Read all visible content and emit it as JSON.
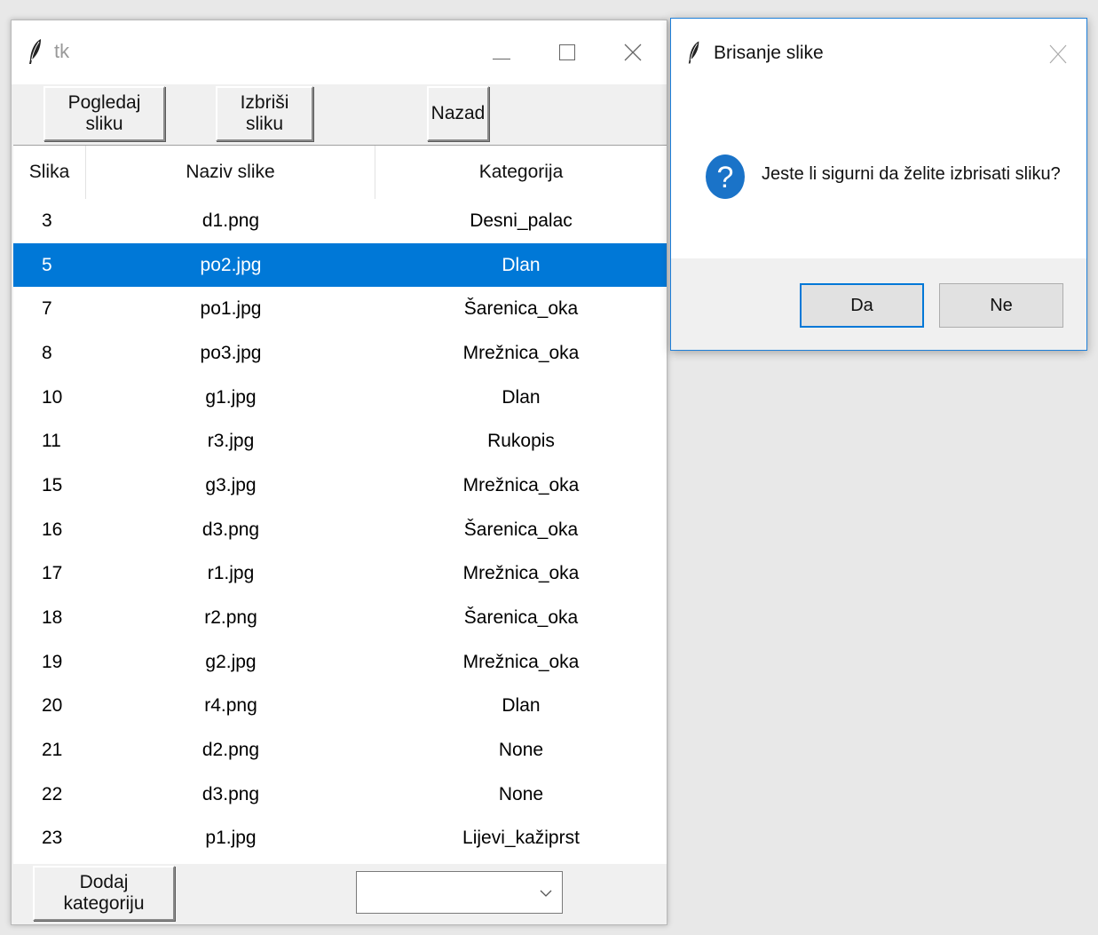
{
  "main_window": {
    "title": "tk",
    "toolbar": {
      "view_label": "Pogledaj sliku",
      "delete_label": "Izbriši sliku",
      "back_label": "Nazad"
    },
    "table": {
      "columns": [
        "Slika",
        "Naziv slike",
        "Kategorija"
      ],
      "selected_row_index": 1,
      "rows": [
        {
          "id": "3",
          "name": "d1.png",
          "category": "Desni_palac"
        },
        {
          "id": "5",
          "name": "po2.jpg",
          "category": "Dlan"
        },
        {
          "id": "7",
          "name": "po1.jpg",
          "category": "Šarenica_oka"
        },
        {
          "id": "8",
          "name": "po3.jpg",
          "category": "Mrežnica_oka"
        },
        {
          "id": "10",
          "name": "g1.jpg",
          "category": "Dlan"
        },
        {
          "id": "11",
          "name": "r3.jpg",
          "category": "Rukopis"
        },
        {
          "id": "15",
          "name": "g3.jpg",
          "category": "Mrežnica_oka"
        },
        {
          "id": "16",
          "name": "d3.png",
          "category": "Šarenica_oka"
        },
        {
          "id": "17",
          "name": "r1.jpg",
          "category": "Mrežnica_oka"
        },
        {
          "id": "18",
          "name": "r2.png",
          "category": "Šarenica_oka"
        },
        {
          "id": "19",
          "name": "g2.jpg",
          "category": "Mrežnica_oka"
        },
        {
          "id": "20",
          "name": "r4.png",
          "category": "Dlan"
        },
        {
          "id": "21",
          "name": "d2.png",
          "category": "None"
        },
        {
          "id": "22",
          "name": "d3.png",
          "category": "None"
        },
        {
          "id": "23",
          "name": "p1.jpg",
          "category": "Lijevi_kažiprst"
        }
      ]
    },
    "bottom": {
      "add_category_label": "Dodaj kategoriju",
      "category_combo_value": ""
    }
  },
  "dialog": {
    "title": "Brisanje slike",
    "message": "Jeste li sigurni da želite izbrisati sliku?",
    "icon": "question-icon",
    "yes_label": "Da",
    "no_label": "Ne"
  },
  "colors": {
    "selection": "#0078d7",
    "question_icon": "#1a73c8",
    "dialog_border": "#1e7fd9"
  }
}
